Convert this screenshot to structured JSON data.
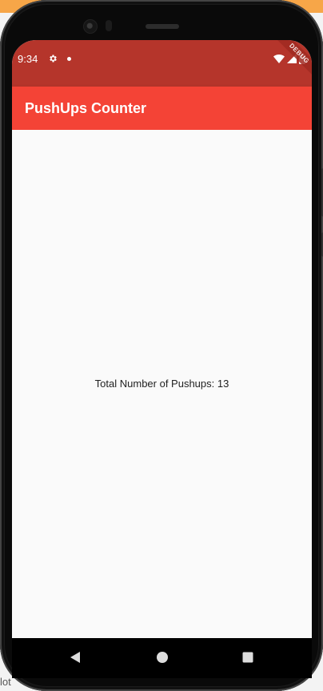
{
  "status_bar": {
    "time": "9:34",
    "debug_banner": "DEBUG"
  },
  "app_bar": {
    "title": "PushUps Counter"
  },
  "body": {
    "counter_text": "Total Number of Pushups: 13"
  },
  "fab": {
    "icon": "plus-icon"
  },
  "nav": {
    "back_icon": "back-triangle-icon",
    "home_icon": "home-circle-icon",
    "recents_icon": "recents-square-icon"
  },
  "desktop": {
    "fragment_text": "lot"
  },
  "colors": {
    "status_bar": "#b5352b",
    "app_bar": "#f44336",
    "fab": "#ff5252",
    "background": "#fafafa"
  }
}
